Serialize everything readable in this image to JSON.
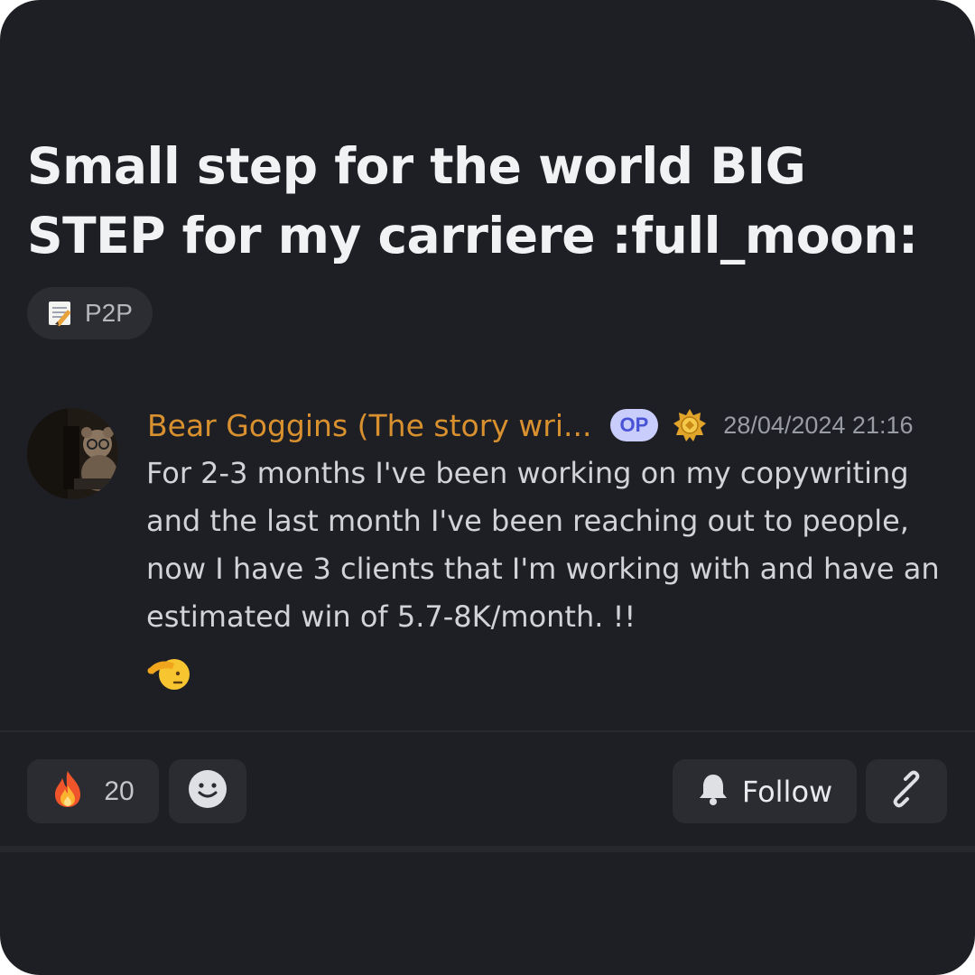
{
  "post": {
    "title": "Small step for the world BIG STEP for my carriere :full_moon:",
    "tag": {
      "icon": "memo-icon",
      "label": "P2P"
    }
  },
  "message": {
    "author": "Bear Goggins (The story wri...",
    "author_color": "#d9912f",
    "op_badge": "OP",
    "role_icon": "gold-badge-icon",
    "timestamp": "28/04/2024 21:16",
    "body": "For 2-3 months I've been working on my copywriting and the last month I've been reaching out to people, now I have 3 clients that I'm working with and have an estimated win of 5.7-8K/month. !!",
    "trailing_emoji": "saluting-face-emoji"
  },
  "actions": {
    "reaction": {
      "icon": "fire-icon",
      "count": "20"
    },
    "add_reaction_icon": "smiley-icon",
    "follow": {
      "icon": "bell-icon",
      "label": "Follow"
    },
    "copy_link_icon": "link-icon"
  }
}
